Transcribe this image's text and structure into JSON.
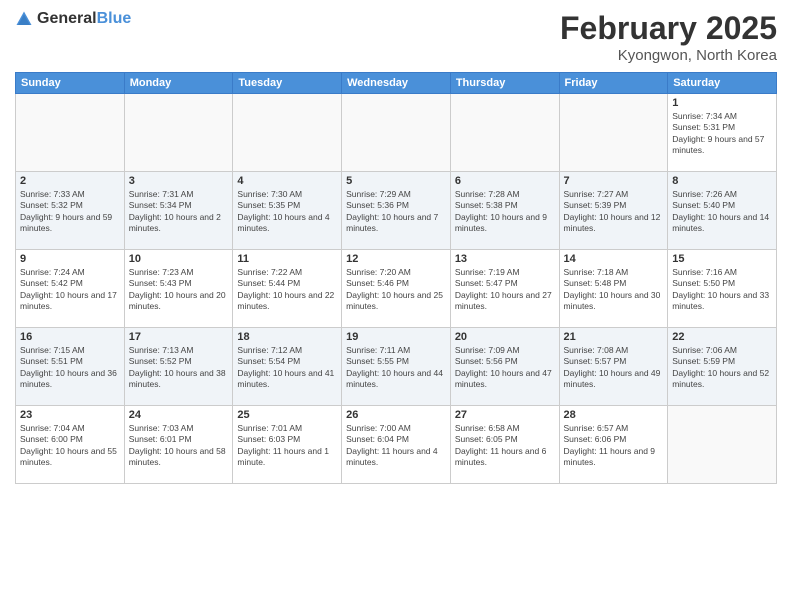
{
  "header": {
    "logo_general": "General",
    "logo_blue": "Blue",
    "month": "February 2025",
    "location": "Kyongwon, North Korea"
  },
  "days_of_week": [
    "Sunday",
    "Monday",
    "Tuesday",
    "Wednesday",
    "Thursday",
    "Friday",
    "Saturday"
  ],
  "weeks": [
    {
      "alt": false,
      "days": [
        {
          "num": "",
          "info": ""
        },
        {
          "num": "",
          "info": ""
        },
        {
          "num": "",
          "info": ""
        },
        {
          "num": "",
          "info": ""
        },
        {
          "num": "",
          "info": ""
        },
        {
          "num": "",
          "info": ""
        },
        {
          "num": "1",
          "info": "Sunrise: 7:34 AM\nSunset: 5:31 PM\nDaylight: 9 hours and 57 minutes."
        }
      ]
    },
    {
      "alt": true,
      "days": [
        {
          "num": "2",
          "info": "Sunrise: 7:33 AM\nSunset: 5:32 PM\nDaylight: 9 hours and 59 minutes."
        },
        {
          "num": "3",
          "info": "Sunrise: 7:31 AM\nSunset: 5:34 PM\nDaylight: 10 hours and 2 minutes."
        },
        {
          "num": "4",
          "info": "Sunrise: 7:30 AM\nSunset: 5:35 PM\nDaylight: 10 hours and 4 minutes."
        },
        {
          "num": "5",
          "info": "Sunrise: 7:29 AM\nSunset: 5:36 PM\nDaylight: 10 hours and 7 minutes."
        },
        {
          "num": "6",
          "info": "Sunrise: 7:28 AM\nSunset: 5:38 PM\nDaylight: 10 hours and 9 minutes."
        },
        {
          "num": "7",
          "info": "Sunrise: 7:27 AM\nSunset: 5:39 PM\nDaylight: 10 hours and 12 minutes."
        },
        {
          "num": "8",
          "info": "Sunrise: 7:26 AM\nSunset: 5:40 PM\nDaylight: 10 hours and 14 minutes."
        }
      ]
    },
    {
      "alt": false,
      "days": [
        {
          "num": "9",
          "info": "Sunrise: 7:24 AM\nSunset: 5:42 PM\nDaylight: 10 hours and 17 minutes."
        },
        {
          "num": "10",
          "info": "Sunrise: 7:23 AM\nSunset: 5:43 PM\nDaylight: 10 hours and 20 minutes."
        },
        {
          "num": "11",
          "info": "Sunrise: 7:22 AM\nSunset: 5:44 PM\nDaylight: 10 hours and 22 minutes."
        },
        {
          "num": "12",
          "info": "Sunrise: 7:20 AM\nSunset: 5:46 PM\nDaylight: 10 hours and 25 minutes."
        },
        {
          "num": "13",
          "info": "Sunrise: 7:19 AM\nSunset: 5:47 PM\nDaylight: 10 hours and 27 minutes."
        },
        {
          "num": "14",
          "info": "Sunrise: 7:18 AM\nSunset: 5:48 PM\nDaylight: 10 hours and 30 minutes."
        },
        {
          "num": "15",
          "info": "Sunrise: 7:16 AM\nSunset: 5:50 PM\nDaylight: 10 hours and 33 minutes."
        }
      ]
    },
    {
      "alt": true,
      "days": [
        {
          "num": "16",
          "info": "Sunrise: 7:15 AM\nSunset: 5:51 PM\nDaylight: 10 hours and 36 minutes."
        },
        {
          "num": "17",
          "info": "Sunrise: 7:13 AM\nSunset: 5:52 PM\nDaylight: 10 hours and 38 minutes."
        },
        {
          "num": "18",
          "info": "Sunrise: 7:12 AM\nSunset: 5:54 PM\nDaylight: 10 hours and 41 minutes."
        },
        {
          "num": "19",
          "info": "Sunrise: 7:11 AM\nSunset: 5:55 PM\nDaylight: 10 hours and 44 minutes."
        },
        {
          "num": "20",
          "info": "Sunrise: 7:09 AM\nSunset: 5:56 PM\nDaylight: 10 hours and 47 minutes."
        },
        {
          "num": "21",
          "info": "Sunrise: 7:08 AM\nSunset: 5:57 PM\nDaylight: 10 hours and 49 minutes."
        },
        {
          "num": "22",
          "info": "Sunrise: 7:06 AM\nSunset: 5:59 PM\nDaylight: 10 hours and 52 minutes."
        }
      ]
    },
    {
      "alt": false,
      "days": [
        {
          "num": "23",
          "info": "Sunrise: 7:04 AM\nSunset: 6:00 PM\nDaylight: 10 hours and 55 minutes."
        },
        {
          "num": "24",
          "info": "Sunrise: 7:03 AM\nSunset: 6:01 PM\nDaylight: 10 hours and 58 minutes."
        },
        {
          "num": "25",
          "info": "Sunrise: 7:01 AM\nSunset: 6:03 PM\nDaylight: 11 hours and 1 minute."
        },
        {
          "num": "26",
          "info": "Sunrise: 7:00 AM\nSunset: 6:04 PM\nDaylight: 11 hours and 4 minutes."
        },
        {
          "num": "27",
          "info": "Sunrise: 6:58 AM\nSunset: 6:05 PM\nDaylight: 11 hours and 6 minutes."
        },
        {
          "num": "28",
          "info": "Sunrise: 6:57 AM\nSunset: 6:06 PM\nDaylight: 11 hours and 9 minutes."
        },
        {
          "num": "",
          "info": ""
        }
      ]
    }
  ]
}
